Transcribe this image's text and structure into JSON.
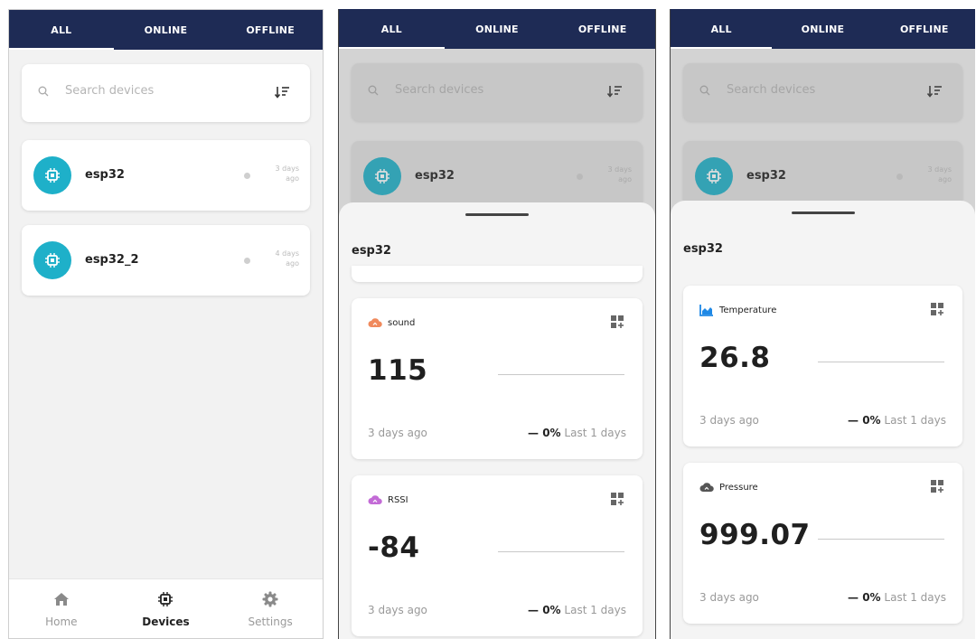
{
  "tabs": [
    "ALL",
    "ONLINE",
    "OFFLINE"
  ],
  "search": {
    "placeholder": "Search devices"
  },
  "devices": [
    {
      "name": "esp32",
      "last_seen": "3 days ago"
    },
    {
      "name": "esp32_2",
      "last_seen": "4 days ago"
    }
  ],
  "nav": {
    "home": "Home",
    "devices": "Devices",
    "settings": "Settings"
  },
  "sheet": {
    "device_name": "esp32"
  },
  "widgets_a": [
    {
      "name": "sound",
      "value": "115",
      "time": "3 days ago",
      "change": "0%",
      "period": "Last 1 days",
      "icon": "cloud-icon",
      "color": "#f08a5d"
    },
    {
      "name": "RSSI",
      "value": "-84",
      "time": "3 days ago",
      "change": "0%",
      "period": "Last 1 days",
      "icon": "cloud-icon",
      "color": "#c36bd6"
    }
  ],
  "widgets_b": [
    {
      "name": "Temperature",
      "value": "26.8",
      "time": "3 days ago",
      "change": "0%",
      "period": "Last 1 days",
      "icon": "area-chart-icon",
      "color": "#1e88e5"
    },
    {
      "name": "Pressure",
      "value": "999.07",
      "time": "3 days ago",
      "change": "0%",
      "period": "Last 1 days",
      "icon": "cloud-icon",
      "color": "#555555"
    }
  ],
  "colors": {
    "header": "#1e2b55",
    "accent": "#1eb0c9"
  }
}
